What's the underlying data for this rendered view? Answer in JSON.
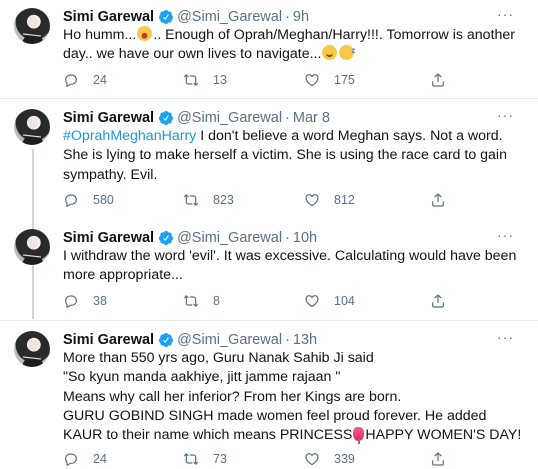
{
  "tweets": [
    {
      "name": "Simi Garewal",
      "handle": "@Simi_Garewal",
      "time": "9h",
      "text_a": "Ho humm...",
      "text_b": ".. Enough of Oprah/Meghan/Harry!!!. Tomorrow is another day.. we have our own lives to navigate...",
      "emoji": [
        "yawning-face",
        "smiling-face",
        "sleepy-face"
      ],
      "replies": "24",
      "retweets": "13",
      "likes": "175"
    },
    {
      "name": "Simi Garewal",
      "handle": "@Simi_Garewal",
      "time": "Mar 8",
      "hashtag": "#OprahMeghanHarry",
      "text": " I don't believe a word Meghan says. Not a word. She is lying to make herself a victim. She is using the race card to gain sympathy. Evil.",
      "replies": "580",
      "retweets": "823",
      "likes": "812"
    },
    {
      "name": "Simi Garewal",
      "handle": "@Simi_Garewal",
      "time": "10h",
      "text": "I withdraw the word 'evil'. It was excessive. Calculating would have been more appropriate...",
      "replies": "38",
      "retweets": "8",
      "likes": "104"
    },
    {
      "name": "Simi Garewal",
      "handle": "@Simi_Garewal",
      "time": "13h",
      "text_a": "More than 550 yrs ago, Guru Nanak Sahib Ji said\n\"So kyun manda aakhiye, jitt jamme rajaan \"\nMeans why call her inferior? From her Kings are born.\nGURU GOBIND SINGH made women feel proud forever. He added KAUR to their name which means PRINCESS",
      "text_b": "HAPPY WOMEN'S DAY!",
      "emoji": [
        "tulip"
      ],
      "replies": "24",
      "retweets": "73",
      "likes": "339"
    }
  ],
  "separator_dot": "·",
  "more_label": "···",
  "colors": {
    "accent": "#1b95e0",
    "muted": "#5b7083",
    "text": "#0f1419",
    "divider": "#e6ecf0",
    "thread": "#ccd6dd"
  }
}
